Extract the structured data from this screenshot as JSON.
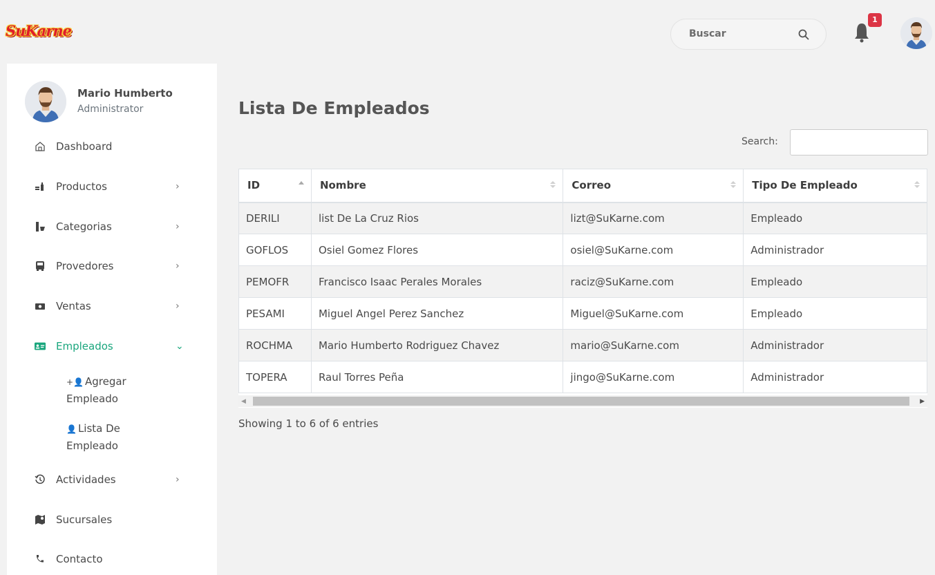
{
  "header": {
    "brand": "SuKarne",
    "search_placeholder": "Buscar",
    "notification_count": "1"
  },
  "user": {
    "name": "Mario Humberto",
    "role": "Administrator"
  },
  "sidebar": {
    "items": [
      {
        "label": "Dashboard",
        "icon": "home-icon"
      },
      {
        "label": "Productos",
        "icon": "products-icon"
      },
      {
        "label": "Categorias",
        "icon": "categories-icon"
      },
      {
        "label": "Provedores",
        "icon": "bus-icon"
      },
      {
        "label": "Ventas",
        "icon": "money-icon"
      },
      {
        "label": "Empleados",
        "icon": "id-card-icon"
      },
      {
        "label": "Actividades",
        "icon": "history-icon"
      },
      {
        "label": "Sucursales",
        "icon": "map-icon"
      },
      {
        "label": "Contacto",
        "icon": "phone-icon"
      }
    ],
    "sub_items": [
      {
        "label": "Agregar Empleado",
        "icon": "add-user-icon"
      },
      {
        "label": "Lista De Empleado",
        "icon": "user-list-icon"
      }
    ],
    "active_color": "#1aa67d"
  },
  "main": {
    "title": "Lista De Empleados",
    "search_label": "Search:",
    "table": {
      "columns": [
        "ID",
        "Nombre",
        "Correo",
        "Tipo De Empleado"
      ],
      "rows": [
        [
          "DERILI",
          "list De La Cruz Rios",
          "lizt@SuKarne.com",
          "Empleado"
        ],
        [
          "GOFLOS",
          "Osiel Gomez Flores",
          "osiel@SuKarne.com",
          "Administrador"
        ],
        [
          "PEMOFR",
          "Francisco Isaac Perales Morales",
          "raciz@SuKarne.com",
          "Empleado"
        ],
        [
          "PESAMI",
          "Miguel Angel Perez Sanchez",
          "Miguel@SuKarne.com",
          "Empleado"
        ],
        [
          "ROCHMA",
          "Mario Humberto Rodriguez Chavez",
          "mario@SuKarne.com",
          "Administrador"
        ],
        [
          "TOPERA",
          "Raul Torres Peña",
          "jingo@SuKarne.com",
          "Administrador"
        ]
      ]
    },
    "info": "Showing 1 to 6 of 6 entries"
  }
}
